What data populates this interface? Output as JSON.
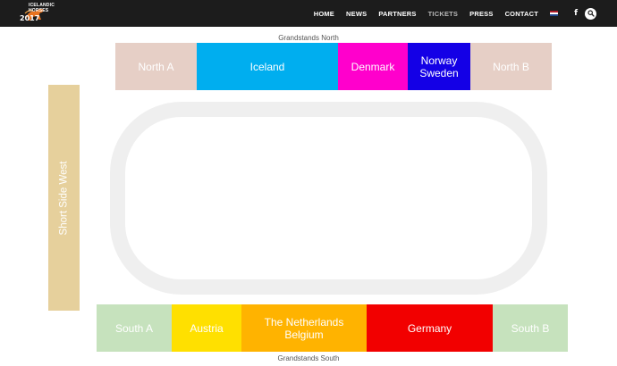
{
  "header": {
    "logo_line1": "ICELANDIC",
    "logo_line2": "HORSES",
    "logo_year": "2017",
    "nav": [
      {
        "label": "HOME",
        "active": false
      },
      {
        "label": "NEWS",
        "active": false
      },
      {
        "label": "PARTNERS",
        "active": false
      },
      {
        "label": "TICKETS",
        "active": true
      },
      {
        "label": "PRESS",
        "active": false
      },
      {
        "label": "CONTACT",
        "active": false
      }
    ],
    "facebook_glyph": "f",
    "flag_colors": [
      "#ae1c28",
      "#ffffff",
      "#21468b"
    ]
  },
  "map": {
    "north_caption": "Grandstands North",
    "south_caption": "Grandstands South",
    "west_label": "Short Side West",
    "north_sections": [
      {
        "label": "North A",
        "color": "#e6cfc6"
      },
      {
        "label": "Iceland",
        "color": "#00aeef"
      },
      {
        "label": "Denmark",
        "color": "#ff00cc"
      },
      {
        "label": "Norway\nSweden",
        "color": "#1400e6"
      },
      {
        "label": "North B",
        "color": "#e6cfc6"
      }
    ],
    "south_sections": [
      {
        "label": "South A",
        "color": "#c6e2bd"
      },
      {
        "label": "Austria",
        "color": "#ffe000"
      },
      {
        "label": "The Netherlands\nBelgium",
        "color": "#ffb300"
      },
      {
        "label": "Germany",
        "color": "#f20000"
      },
      {
        "label": "South B",
        "color": "#c6e2bd"
      }
    ],
    "west_color": "#e6d09c",
    "track_color": "#efefef"
  }
}
